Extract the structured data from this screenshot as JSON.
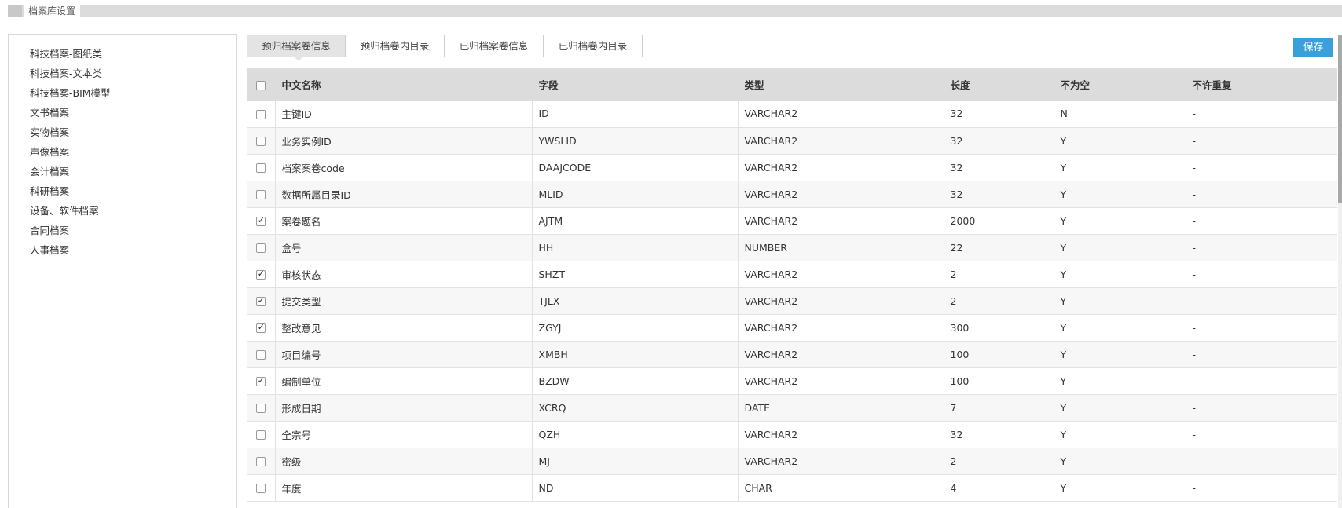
{
  "header": {
    "title": "档案库设置"
  },
  "sidebar": {
    "items": [
      {
        "label": "科技档案-图纸类",
        "active": true
      },
      {
        "label": "科技档案-文本类"
      },
      {
        "label": "科技档案-BIM模型"
      },
      {
        "label": "文书档案"
      },
      {
        "label": "实物档案"
      },
      {
        "label": "声像档案"
      },
      {
        "label": "会计档案"
      },
      {
        "label": "科研档案"
      },
      {
        "label": "设备、软件档案"
      },
      {
        "label": "合同档案"
      },
      {
        "label": "人事档案"
      }
    ]
  },
  "tabs": [
    {
      "label": "预归档案卷信息",
      "active": true
    },
    {
      "label": "预归档卷内目录"
    },
    {
      "label": "已归档案卷信息"
    },
    {
      "label": "已归档卷内目录"
    }
  ],
  "toolbar": {
    "save_label": "保存"
  },
  "table": {
    "columns": [
      "中文名称",
      "字段",
      "类型",
      "长度",
      "不为空",
      "不许重复"
    ],
    "rows": [
      {
        "checked": false,
        "cells": [
          "主键ID",
          "ID",
          "VARCHAR2",
          "32",
          "N",
          "-"
        ]
      },
      {
        "checked": false,
        "cells": [
          "业务实例ID",
          "YWSLID",
          "VARCHAR2",
          "32",
          "Y",
          "-"
        ]
      },
      {
        "checked": false,
        "cells": [
          "档案案卷code",
          "DAAJCODE",
          "VARCHAR2",
          "32",
          "Y",
          "-"
        ]
      },
      {
        "checked": false,
        "cells": [
          "数据所属目录ID",
          "MLID",
          "VARCHAR2",
          "32",
          "Y",
          "-"
        ]
      },
      {
        "checked": true,
        "cells": [
          "案卷题名",
          "AJTM",
          "VARCHAR2",
          "2000",
          "Y",
          "-"
        ]
      },
      {
        "checked": false,
        "cells": [
          "盒号",
          "HH",
          "NUMBER",
          "22",
          "Y",
          "-"
        ]
      },
      {
        "checked": true,
        "cells": [
          "审核状态",
          "SHZT",
          "VARCHAR2",
          "2",
          "Y",
          "-"
        ]
      },
      {
        "checked": true,
        "cells": [
          "提交类型",
          "TJLX",
          "VARCHAR2",
          "2",
          "Y",
          "-"
        ]
      },
      {
        "checked": true,
        "cells": [
          "整改意见",
          "ZGYJ",
          "VARCHAR2",
          "300",
          "Y",
          "-"
        ]
      },
      {
        "checked": false,
        "cells": [
          "项目编号",
          "XMBH",
          "VARCHAR2",
          "100",
          "Y",
          "-"
        ]
      },
      {
        "checked": true,
        "cells": [
          "编制单位",
          "BZDW",
          "VARCHAR2",
          "100",
          "Y",
          "-"
        ]
      },
      {
        "checked": false,
        "cells": [
          "形成日期",
          "XCRQ",
          "DATE",
          "7",
          "Y",
          "-"
        ]
      },
      {
        "checked": false,
        "cells": [
          "全宗号",
          "QZH",
          "VARCHAR2",
          "32",
          "Y",
          "-"
        ]
      },
      {
        "checked": false,
        "cells": [
          "密级",
          "MJ",
          "VARCHAR2",
          "2",
          "Y",
          "-"
        ]
      },
      {
        "checked": false,
        "cells": [
          "年度",
          "ND",
          "CHAR",
          "4",
          "Y",
          "-"
        ]
      }
    ]
  },
  "colors": {
    "accent": "#1e90d8",
    "button": "#3aa0dc",
    "header_bg": "#dcdcdc"
  }
}
